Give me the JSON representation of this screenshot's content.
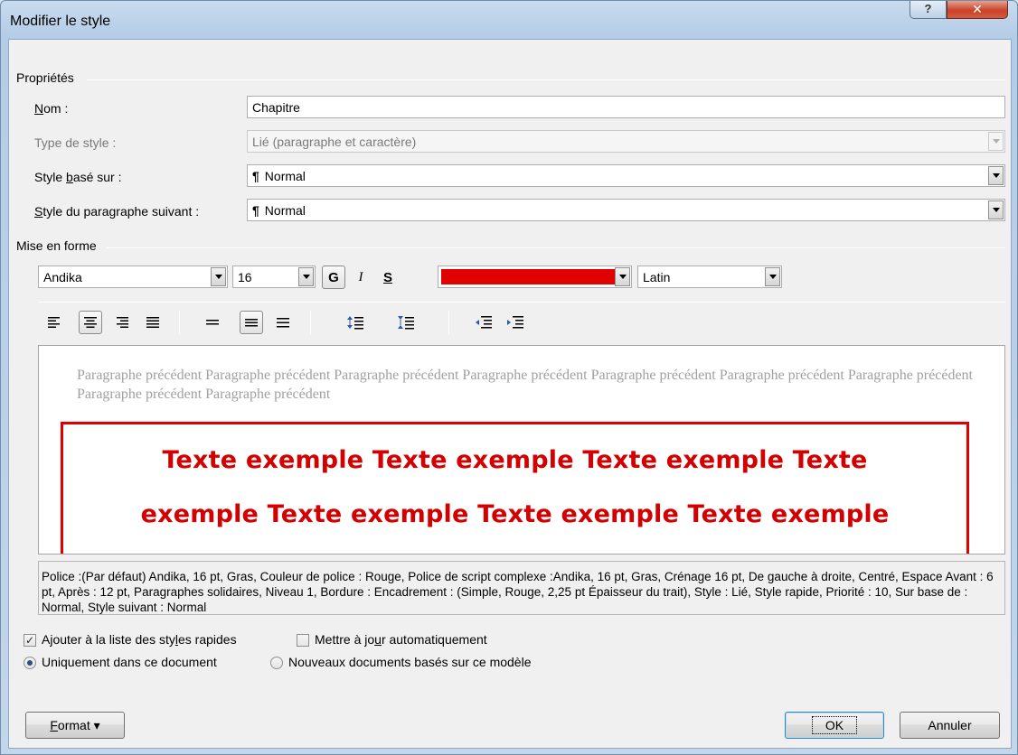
{
  "window": {
    "title": "Modifier le style",
    "help_label": "?",
    "close_label": "✕"
  },
  "properties": {
    "group_title": "Propriétés",
    "name_label_u": "N",
    "name_label_rest": "om :",
    "name_value": "Chapitre",
    "type_label": "Type de style :",
    "type_value": "Lié (paragraphe et caractère)",
    "based_label_a": "Style ",
    "based_label_u": "b",
    "based_label_b": "asé sur :",
    "based_value": "Normal",
    "next_label_u": "S",
    "next_label_rest": "tyle du paragraphe suivant :",
    "next_value": "Normal",
    "pilcrow": "¶"
  },
  "formatting": {
    "group_title": "Mise en forme",
    "font": "Andika",
    "size": "16",
    "bold": "G",
    "italic": "I",
    "underline": "S",
    "color": "#e00000",
    "script": "Latin"
  },
  "preview": {
    "previous_paragraph": "Paragraphe précédent Paragraphe précédent Paragraphe précédent Paragraphe précédent Paragraphe précédent Paragraphe précédent Paragraphe précédent Paragraphe précédent Paragraphe précédent",
    "sample_line1": "Texte exemple Texte exemple Texte exemple Texte",
    "sample_line2": "exemple Texte exemple Texte exemple Texte exemple"
  },
  "description": "Police :(Par défaut) Andika, 16 pt, Gras, Couleur de police : Rouge, Police de script complexe :Andika, 16 pt, Gras, Crénage 16 pt, De gauche à droite, Centré, Espace Avant : 6 pt, Après : 12 pt, Paragraphes solidaires, Niveau 1, Bordure : Encadrement : (Simple, Rouge,  2,25 pt Épaisseur du trait), Style : Lié, Style rapide, Priorité : 10, Sur base de : Normal, Style suivant : Normal",
  "options": {
    "add_quick_a": "Ajouter à la liste des sty",
    "add_quick_u": "l",
    "add_quick_b": "es rapides",
    "add_quick_checked": true,
    "auto_update_a": "Mettre à jo",
    "auto_update_u": "u",
    "auto_update_b": "r automatiquement",
    "auto_update_checked": false,
    "only_doc": "Uniquement dans ce document",
    "new_docs": "Nouveaux documents basés sur ce modèle"
  },
  "buttons": {
    "format_u": "F",
    "format_rest": "ormat",
    "format_arrow": "▾",
    "ok": "OK",
    "cancel": "Annuler"
  }
}
